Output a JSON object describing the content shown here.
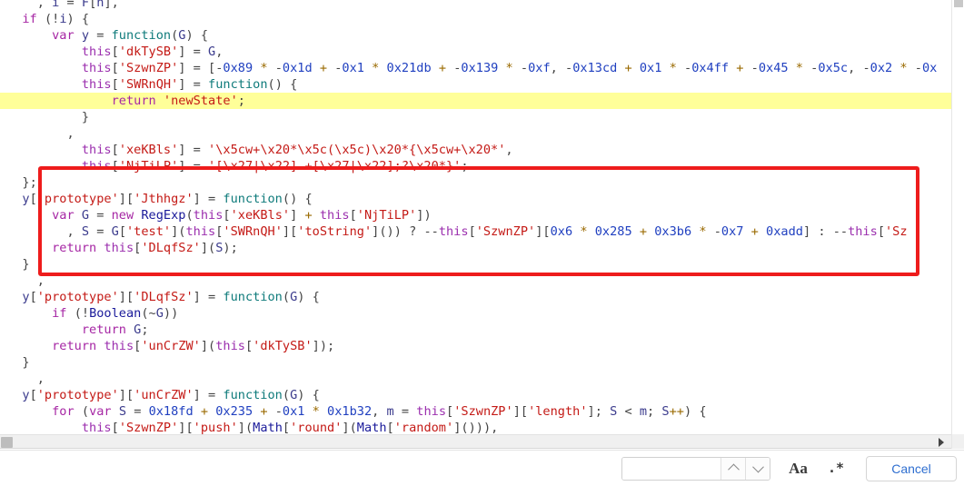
{
  "editor": {
    "language": "javascript",
    "highlight_color": "#ffff99",
    "annotation_box_color": "#ee1c1c",
    "lines": [
      {
        "indent": 0,
        "text": "    , i = F[n],",
        "highlighted": false
      },
      {
        "indent": 0,
        "text": "  if (!i) {",
        "highlighted": false
      },
      {
        "indent": 0,
        "text": "      var y = function(G) {",
        "highlighted": false
      },
      {
        "indent": 0,
        "text": "          this['dkTySB'] = G,",
        "highlighted": false
      },
      {
        "indent": 0,
        "text": "          this['SzwnZP'] = [-0x89 * -0x1d + -0x1 * 0x21db + -0x139 * -0xf, -0x13cd + 0x1 * -0x4ff + -0x45 * -0x5c, -0x2 * -0x",
        "highlighted": false
      },
      {
        "indent": 0,
        "text": "          this['SWRnQH'] = function() {",
        "highlighted": false
      },
      {
        "indent": 0,
        "text": "              return 'newState';",
        "highlighted": true
      },
      {
        "indent": 0,
        "text": "          }",
        "highlighted": false
      },
      {
        "indent": 0,
        "text": "        ,",
        "highlighted": false
      },
      {
        "indent": 0,
        "text": "          this['xeKBls'] = '\\x5cw+\\x20*\\x5c(\\x5c)\\x20*{\\x5cw+\\x20*',",
        "highlighted": false
      },
      {
        "indent": 0,
        "text": "          this['NjTiLP'] = '[\\x27|\\x22] +[\\x27|\\x22];?\\x20*}';",
        "highlighted": false
      },
      {
        "indent": 0,
        "text": "  };",
        "highlighted": false
      },
      {
        "indent": 0,
        "text": "  y['prototype']['Jthhgz'] = function() {",
        "highlighted": false
      },
      {
        "indent": 0,
        "text": "      var G = new RegExp(this['xeKBls'] + this['NjTiLP'])",
        "highlighted": false
      },
      {
        "indent": 0,
        "text": "        , S = G['test'](this['SWRnQH']['toString']()) ? --this['SzwnZP'][0x6 * 0x285 + 0x3b6 * -0x7 + 0xadd] : --this['Sz",
        "highlighted": false
      },
      {
        "indent": 0,
        "text": "      return this['DLqfSz'](S);",
        "highlighted": false
      },
      {
        "indent": 0,
        "text": "  }",
        "highlighted": false
      },
      {
        "indent": 0,
        "text": "    ,",
        "highlighted": false
      },
      {
        "indent": 0,
        "text": "  y['prototype']['DLqfSz'] = function(G) {",
        "highlighted": false
      },
      {
        "indent": 0,
        "text": "      if (!Boolean(~G))",
        "highlighted": false
      },
      {
        "indent": 0,
        "text": "          return G;",
        "highlighted": false
      },
      {
        "indent": 0,
        "text": "      return this['unCrZW'](this['dkTySB']);",
        "highlighted": false
      },
      {
        "indent": 0,
        "text": "  }",
        "highlighted": false
      },
      {
        "indent": 0,
        "text": "    ,",
        "highlighted": false
      },
      {
        "indent": 0,
        "text": "  y['prototype']['unCrZW'] = function(G) {",
        "highlighted": false
      },
      {
        "indent": 0,
        "text": "      for (var S = 0x18fd + 0x235 + -0x1 * 0x1b32, m = this['SzwnZP']['length']; S < m; S++) {",
        "highlighted": false
      },
      {
        "indent": 0,
        "text": "          this['SzwnZP']['push'](Math['round'](Math['random']())),",
        "highlighted": false
      }
    ]
  },
  "findbar": {
    "search_value": "",
    "search_placeholder": "",
    "previous_label": "previous-match",
    "next_label": "next-match",
    "match_case_label": "Aa",
    "regex_label": ".*",
    "cancel_label": "Cancel",
    "cancel_color": "#2f6fd0"
  },
  "scrollbars": {
    "horizontal_position": "left",
    "vertical_position": "top"
  }
}
